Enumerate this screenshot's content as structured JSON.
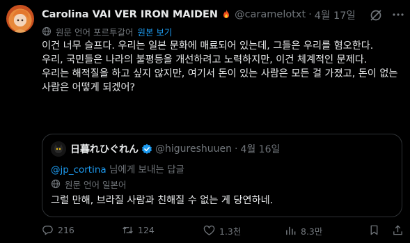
{
  "tweet": {
    "display_name": "Carolina VAI VER IRON MAIDEN",
    "handle": "@caramelotxt",
    "separator": "·",
    "date": "4월 17일",
    "translate": {
      "label": "원문 언어 포르투갈어",
      "link": "원본 보기"
    },
    "paragraphs": [
      "이건 너무 슬프다. 우리는 일본 문화에 매료되어 있는데, 그들은 우리를 혐오한다.",
      "우리, 국민들은 나라의 불평등을 개선하려고 노력하지만, 이건 체계적인 문제다.",
      "우리는 해적질을 하고 싶지 않지만, 여기서 돈이 있는 사람은 모든 걸 가졌고, 돈이 없는 사람은 어떻게 되겠어?"
    ]
  },
  "quoted": {
    "display_name": "日暮れひぐれん",
    "handle": "@higureshuuen",
    "separator": "·",
    "date": "4월 16일",
    "reply_to_mention": "@jp_cortina",
    "reply_to_suffix": " 님에게 보내는 답글",
    "translate_label": "원문 언어 일본어",
    "text": "그럴 만해, 브라질 사람과 친해질 수 없는 게 당연하네."
  },
  "actions": {
    "replies": "216",
    "retweets": "124",
    "likes": "1.3천",
    "views": "8.3만"
  },
  "colors": {
    "background": "#000000",
    "text": "#e7e9ea",
    "muted": "#71767b",
    "accent": "#1d9bf0",
    "border": "#2f3336"
  },
  "icons": [
    "fire-icon",
    "grok-icon",
    "more-icon",
    "globe-icon",
    "verified-icon",
    "reply-icon",
    "retweet-icon",
    "like-icon",
    "views-icon",
    "bookmark-icon",
    "share-icon"
  ]
}
